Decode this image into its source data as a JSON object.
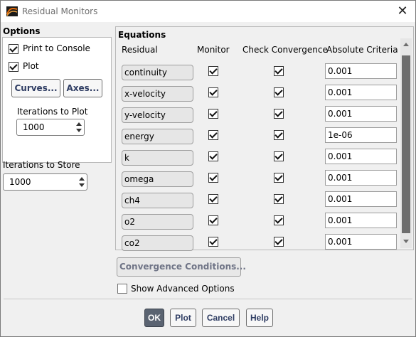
{
  "window": {
    "title": "Residual Monitors",
    "close_label": "✕"
  },
  "options": {
    "title": "Options",
    "print_to_console": {
      "label": "Print to Console",
      "checked": true
    },
    "plot": {
      "label": "Plot",
      "checked": true
    },
    "curves_label": "Curves...",
    "axes_label": "Axes...",
    "iterations_to_plot_label": "Iterations to Plot",
    "iterations_to_plot_value": "1000"
  },
  "store": {
    "label": "Iterations to Store",
    "value": "1000"
  },
  "equations": {
    "title": "Equations",
    "headers": {
      "residual": "Residual",
      "monitor": "Monitor",
      "check": "Check Convergence",
      "criteria": "Absolute Criteria"
    },
    "rows": [
      {
        "name": "continuity",
        "monitor": true,
        "check": true,
        "criteria": "0.001"
      },
      {
        "name": "x-velocity",
        "monitor": true,
        "check": true,
        "criteria": "0.001"
      },
      {
        "name": "y-velocity",
        "monitor": true,
        "check": true,
        "criteria": "0.001"
      },
      {
        "name": "energy",
        "monitor": true,
        "check": true,
        "criteria": "1e-06"
      },
      {
        "name": "k",
        "monitor": true,
        "check": true,
        "criteria": "0.001"
      },
      {
        "name": "omega",
        "monitor": true,
        "check": true,
        "criteria": "0.001"
      },
      {
        "name": "ch4",
        "monitor": true,
        "check": true,
        "criteria": "0.001"
      },
      {
        "name": "o2",
        "monitor": true,
        "check": true,
        "criteria": "0.001"
      },
      {
        "name": "co2",
        "monitor": true,
        "check": true,
        "criteria": "0.001"
      }
    ]
  },
  "convergence_conditions_label": "Convergence Conditions...",
  "show_advanced": {
    "label": "Show Advanced Options",
    "checked": false
  },
  "footer": {
    "ok": "OK",
    "plot": "Plot",
    "cancel": "Cancel",
    "help": "Help"
  }
}
